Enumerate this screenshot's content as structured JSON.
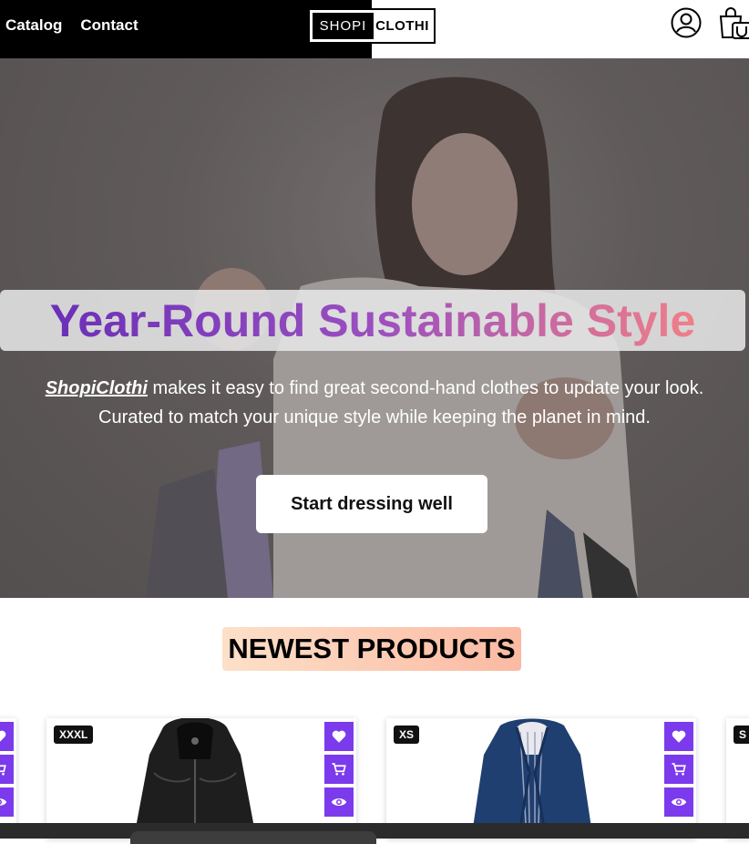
{
  "nav": {
    "catalog": "Catalog",
    "contact": "Contact"
  },
  "logo": {
    "part1": "SHOPI",
    "part2": "CLOTHI"
  },
  "hero": {
    "title": "Year-Round Sustainable Style",
    "brand": "ShopiClothi",
    "line1_rest": " makes it easy to find great second-hand clothes to update your look.",
    "line2": "Curated to match your unique style while keeping the planet in mind.",
    "cta": "Start dressing well"
  },
  "section": {
    "title": "NEWEST PRODUCTS"
  },
  "products": [
    {
      "size": "XXXL",
      "item": "black leather jacket"
    },
    {
      "size": "XS",
      "item": "navy blue jacket"
    },
    {
      "size": "S"
    }
  ],
  "colors": {
    "accent": "#7c3aed",
    "title_gradient": [
      "#6b2fb8",
      "#f07f88"
    ],
    "section_badge": [
      "#fde0c8",
      "#fbb9a2"
    ]
  },
  "icons": [
    "account-icon",
    "shopping-bag-icon",
    "heart-icon",
    "cart-icon",
    "eye-icon"
  ]
}
